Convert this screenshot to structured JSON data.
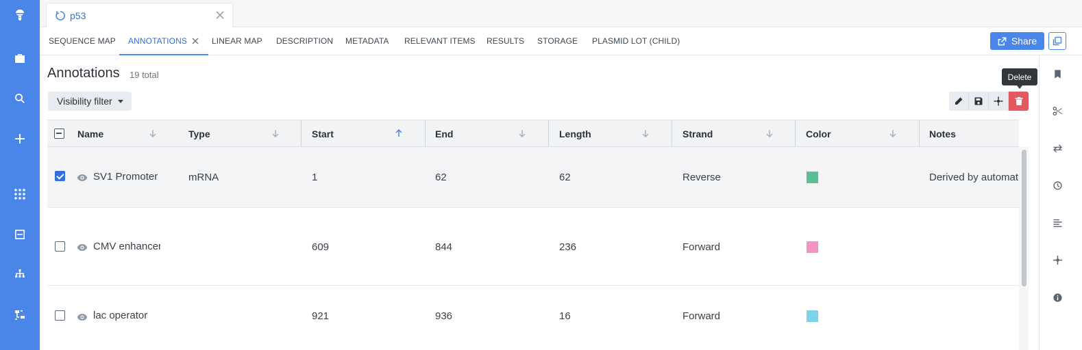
{
  "tab": {
    "title": "p53"
  },
  "view_tabs": [
    "SEQUENCE MAP",
    "ANNOTATIONS",
    "LINEAR MAP",
    "DESCRIPTION",
    "METADATA",
    "RELEVANT ITEMS",
    "RESULTS",
    "STORAGE",
    "PLASMID LOT (CHILD)"
  ],
  "active_view_tab": "ANNOTATIONS",
  "share_label": "Share",
  "heading": "Annotations",
  "count": "19 total",
  "visibility_filter": "Visibility filter",
  "tooltip": "Delete",
  "columns": [
    "Name",
    "Type",
    "Start",
    "End",
    "Length",
    "Strand",
    "Color",
    "Notes"
  ],
  "sorted_column": "Start",
  "rows": [
    {
      "selected": true,
      "name": "SV1 Promoter",
      "type": "mRNA",
      "start": "1",
      "end": "62",
      "length": "62",
      "strand": "Reverse",
      "color": "#5cbf94",
      "notes": "Derived by automat"
    },
    {
      "selected": false,
      "name": "CMV enhancer",
      "type": "",
      "start": "609",
      "end": "844",
      "length": "236",
      "strand": "Forward",
      "color": "#f594c3",
      "notes": ""
    },
    {
      "selected": false,
      "name": "lac operator",
      "type": "",
      "start": "921",
      "end": "936",
      "length": "16",
      "strand": "Forward",
      "color": "#7fd3e6",
      "notes": ""
    }
  ],
  "colors": {
    "accent": "#4a86e8",
    "delete": "#e05a5f",
    "rail": "#4a86e8"
  },
  "icons": {
    "rail": [
      "app-logo-icon",
      "briefcase-icon",
      "search-icon",
      "plus-icon",
      "apps-grid-icon",
      "inbox-icon",
      "hierarchy-icon",
      "workflow-icon"
    ],
    "right_rail": [
      "bookmark-icon",
      "scissors-icon",
      "swap-icon",
      "clock-icon",
      "align-left-icon",
      "crosshair-icon",
      "info-icon"
    ],
    "toolbar": [
      "edit-icon",
      "save-icon",
      "crosshair-icon",
      "trash-icon"
    ]
  }
}
